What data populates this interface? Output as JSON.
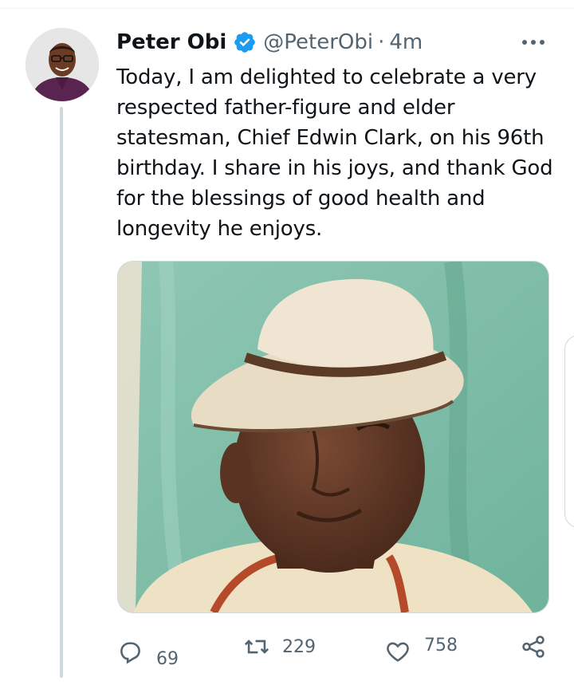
{
  "tweet": {
    "author_name": "Peter Obi",
    "handle": "@PeterObi",
    "separator": "·",
    "time": "4m",
    "text": "Today, I am delighted to celebrate a very\nrespected father-figure and elder\nstatesman, Chief Edwin Clark, on his 96th\nbirthday. I share in his joys, and thank God\nfor the blessings of good health and\nlongevity he enjoys.",
    "verified_icon": "verified-badge-icon",
    "accent_color": "#1d9bf0"
  },
  "actions": {
    "reply_count": "69",
    "retweet_count": "229",
    "like_count": "758"
  },
  "icons": {
    "more": "more-options-icon",
    "reply": "reply-icon",
    "retweet": "retweet-icon",
    "like": "heart-icon",
    "share": "share-icon"
  }
}
